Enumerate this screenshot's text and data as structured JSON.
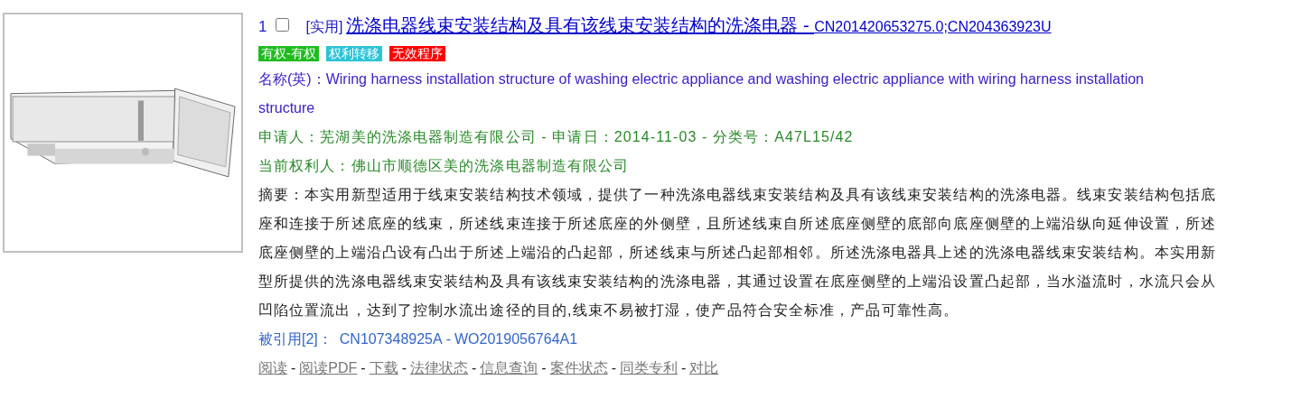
{
  "result": {
    "index": "1",
    "checked": false,
    "type_label": "[实用]",
    "title": "洗涤电器线束安装结构及具有该线束安装结构的洗涤电器 - ",
    "numbers": "CN201420653275.0;CN204363923U",
    "tags": [
      {
        "label": "有权-有权",
        "color": "#1fbb1f"
      },
      {
        "label": "权利转移",
        "color": "#2cc3d8"
      },
      {
        "label": "无效程序",
        "color": "#ff0000"
      }
    ],
    "english_name": "名称(英)：Wiring harness installation structure of washing electric appliance and washing electric appliance with wiring harness installation structure",
    "applicant": "申请人：芜湖美的洗涤电器制造有限公司 - 申请日：2014-11-03 - 分类号：A47L15/42",
    "owner": "当前权利人：佛山市顺德区美的洗涤电器制造有限公司",
    "abstract": "摘要：本实用新型适用于线束安装结构技术领域，提供了一种洗涤电器线束安装结构及具有该线束安装结构的洗涤电器。线束安装结构包括底座和连接于所述底座的线束，所述线束连接于所述底座的外侧壁，且所述线束自所述底座侧壁的底部向底座侧壁的上端沿纵向延伸设置，所述底座侧壁的上端沿凸设有凸出于所述上端沿的凸起部，所述线束与所述凸起部相邻。所述洗涤电器具上述的洗涤电器线束安装结构。本实用新型所提供的洗涤电器线束安装结构及具有该线束安装结构的洗涤电器，其通过设置在底座侧壁的上端沿设置凸起部，当水溢流时，水流只会从凹陷位置流出，达到了控制水流出途径的目的,线束不易被打湿，使产品符合安全标准，产品可靠性高。",
    "cited": {
      "label": "被引用[2]：",
      "items": [
        "CN107348925A",
        "WO2019056764A1"
      ],
      "separator": "-"
    },
    "actions": {
      "items": [
        "阅读",
        "阅读PDF",
        "下载",
        "法律状态",
        "信息查询",
        "案件状态",
        "同类专利",
        "对比"
      ],
      "separator": "-"
    }
  }
}
